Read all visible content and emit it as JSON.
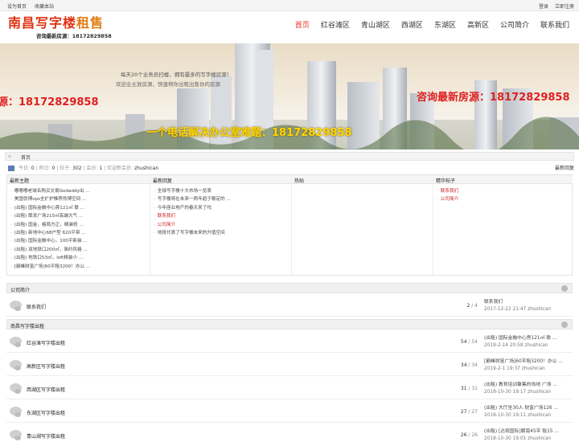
{
  "topbar": {
    "set_home": "设为首页",
    "bookmark": "收藏本站",
    "login": "登录",
    "register": "立即注册"
  },
  "logo": {
    "title_a": "南昌写字楼",
    "title_b": "租售",
    "phone_line": "咨询最新房源：18172829858"
  },
  "nav": [
    "首页",
    "红谷滩区",
    "青山湖区",
    "西湖区",
    "东湖区",
    "高新区",
    "公司简介",
    "联系我们"
  ],
  "banner": {
    "slogan1": "每天20个业务员扫楼，拥有最多的写字楼房源！",
    "slogan2": "欢迎业主放房源，快速帮你出租出售你的房源",
    "phone_left": "源：18172829858",
    "phone_right": "咨询最新房源：18172829858",
    "big_text": "一个电话解决办公室难题：18172829858"
  },
  "breadcrumb": {
    "home": "首页"
  },
  "stats": {
    "today_label": "今日:",
    "today": "0",
    "yesterday_label": "昨日:",
    "yesterday": "0",
    "posts_label": "帖子:",
    "posts": "302",
    "members_label": "会员:",
    "members": "1",
    "welcome": "欢迎新会员:",
    "new_member": "zhushican",
    "latest_reply": "最新回复"
  },
  "panels": {
    "newest": {
      "title": "最新主题",
      "items": [
        "嘟嘟嘟老域名购买交易Godaddy出 ...",
        "美国伪博vps全扩护推荐伪博空间 ...",
        "(出租) 国际金融中心旁121㎡ 联 ...",
        "(出租) 联发广场215㎡高端大气 ...",
        "(出租) 国金，格局方正，精装修 ...",
        "(出租) 新地中心68户型 620平带 ...",
        "(出租) 国际金融中心，100平新装 ...",
        "(出租) 双地铁口200㎡，简约风格 ...",
        "(出租) 地铁口53㎡，loft精装小 ...",
        "[巅峰财富广场]60平租3200！办公 ..."
      ]
    },
    "recent": {
      "title": "最新回复",
      "items": [
        "全球写字楼十大市场一览表",
        "写字楼将在未来一两年趋于稳定的 ...",
        "今年座业地产的春天来了吗",
        "联系我们",
        "公司简介",
        "地段代表了写字楼未来的升值空间"
      ]
    },
    "hot": {
      "title": "热贴",
      "items": []
    },
    "digest": {
      "title": "精华帖子",
      "items": [
        "联系我们",
        "公司简介"
      ]
    }
  },
  "sections": [
    {
      "title": "公司简介",
      "forums": [
        {
          "name": "联系我们",
          "topics": "2",
          "posts": "4",
          "last_title": "联系我们",
          "last_meta": "2017-12-22 21:47 zhushican"
        }
      ]
    },
    {
      "title": "南昌写字楼出租",
      "forums": [
        {
          "name": "红谷滩写字楼出租",
          "topics": "54",
          "posts": "54",
          "last_title": "(出租) 国际金融中心旁121㎡ 联 ...",
          "last_meta": "2019-2-14 20:58 zhushican"
        },
        {
          "name": "高新区写字楼出租",
          "topics": "34",
          "posts": "34",
          "last_title": "[巅峰财富广场]60平租3200！办公 ...",
          "last_meta": "2019-2-1 19:37 zhushican"
        },
        {
          "name": "西湖区写字楼出租",
          "topics": "31",
          "posts": "31",
          "last_title": "(出租) 教育培训聚集的场地 广场 ...",
          "last_meta": "2018-10-30 19:17 zhushican"
        },
        {
          "name": "东湖区写字楼出租",
          "topics": "27",
          "posts": "27",
          "last_title": "(出租) 大厅坐30人 财富广场126 ...",
          "last_meta": "2018-10-30 19:11 zhushican"
        },
        {
          "name": "青山湖写字楼出租",
          "topics": "26",
          "posts": "26",
          "last_title": "(出租) [达观国际]朝南45平 租15 ...",
          "last_meta": "2018-10-30 19:05 zhushican"
        }
      ]
    }
  ]
}
